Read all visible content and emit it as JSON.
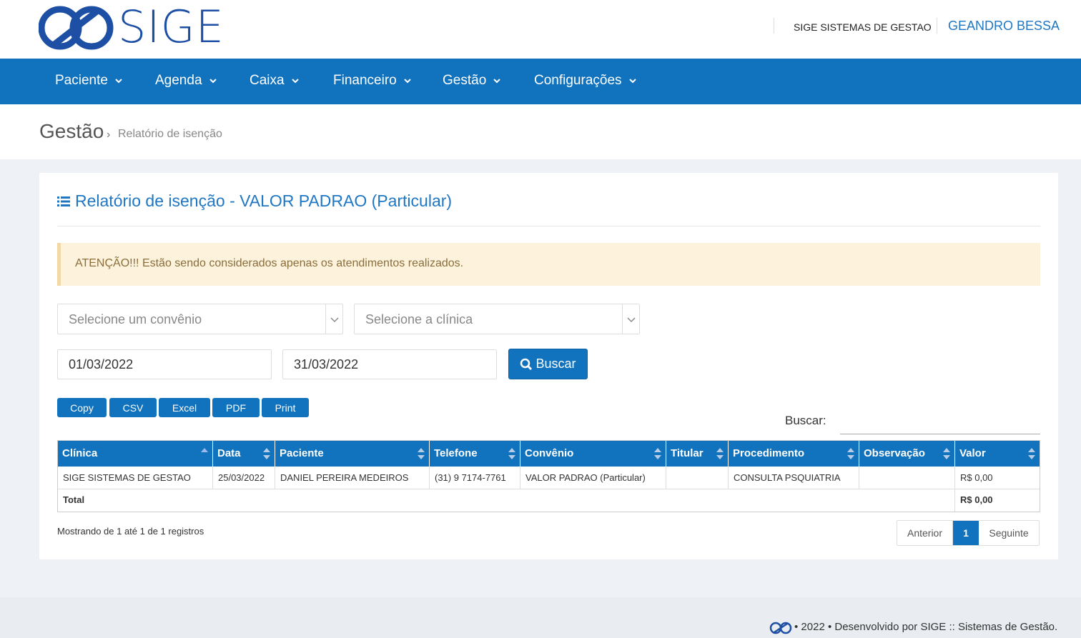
{
  "brand": {
    "name": "SIGE",
    "logo_color": "#1d4fa5"
  },
  "header": {
    "company": "SIGE SISTEMAS DE GESTAO",
    "user": "GEANDRO BESSA"
  },
  "nav": {
    "items": [
      {
        "label": "Paciente"
      },
      {
        "label": "Agenda"
      },
      {
        "label": "Caixa"
      },
      {
        "label": "Financeiro"
      },
      {
        "label": "Gestão"
      },
      {
        "label": "Configurações"
      }
    ]
  },
  "breadcrumb": {
    "section": "Gestão",
    "separator": "›",
    "page": "Relatório de isenção"
  },
  "panel": {
    "title": "Relatório de isenção - VALOR PADRAO (Particular)",
    "title_icon": "list-icon",
    "alert": "ATENÇÃO!!! Estão sendo considerados apenas os atendimentos realizados."
  },
  "filters": {
    "convenio_placeholder": "Selecione um convênio",
    "clinica_placeholder": "Selecione a clínica",
    "date_start": "01/03/2022",
    "date_end": "31/03/2022",
    "search_button": "Buscar"
  },
  "export_buttons": [
    "Copy",
    "CSV",
    "Excel",
    "PDF",
    "Print"
  ],
  "table_search": {
    "label": "Buscar:",
    "value": ""
  },
  "table": {
    "columns": [
      "Clínica",
      "Data",
      "Paciente",
      "Telefone",
      "Convênio",
      "Titular",
      "Procedimento",
      "Observação",
      "Valor"
    ],
    "rows": [
      [
        "SIGE SISTEMAS DE GESTAO",
        "25/03/2022",
        "DANIEL PEREIRA MEDEIROS",
        "(31) 9 7174-7761",
        "VALOR PADRAO (Particular)",
        "",
        "CONSULTA PSQUIATRIA",
        "",
        "R$ 0,00"
      ]
    ],
    "footer": {
      "label": "Total",
      "value": "R$ 0,00"
    }
  },
  "table_info": "Mostrando de 1 até 1 de 1 registros",
  "pagination": {
    "prev": "Anterior",
    "current": "1",
    "next": "Seguinte"
  },
  "footer": {
    "text": "• 2022 • Desenvolvido por SIGE :: Sistemas de Gestão."
  },
  "colors": {
    "primary": "#1172bd",
    "link": "#1f77c4",
    "alert_bg": "#fdf3dd",
    "alert_text": "#8a6d3b"
  }
}
